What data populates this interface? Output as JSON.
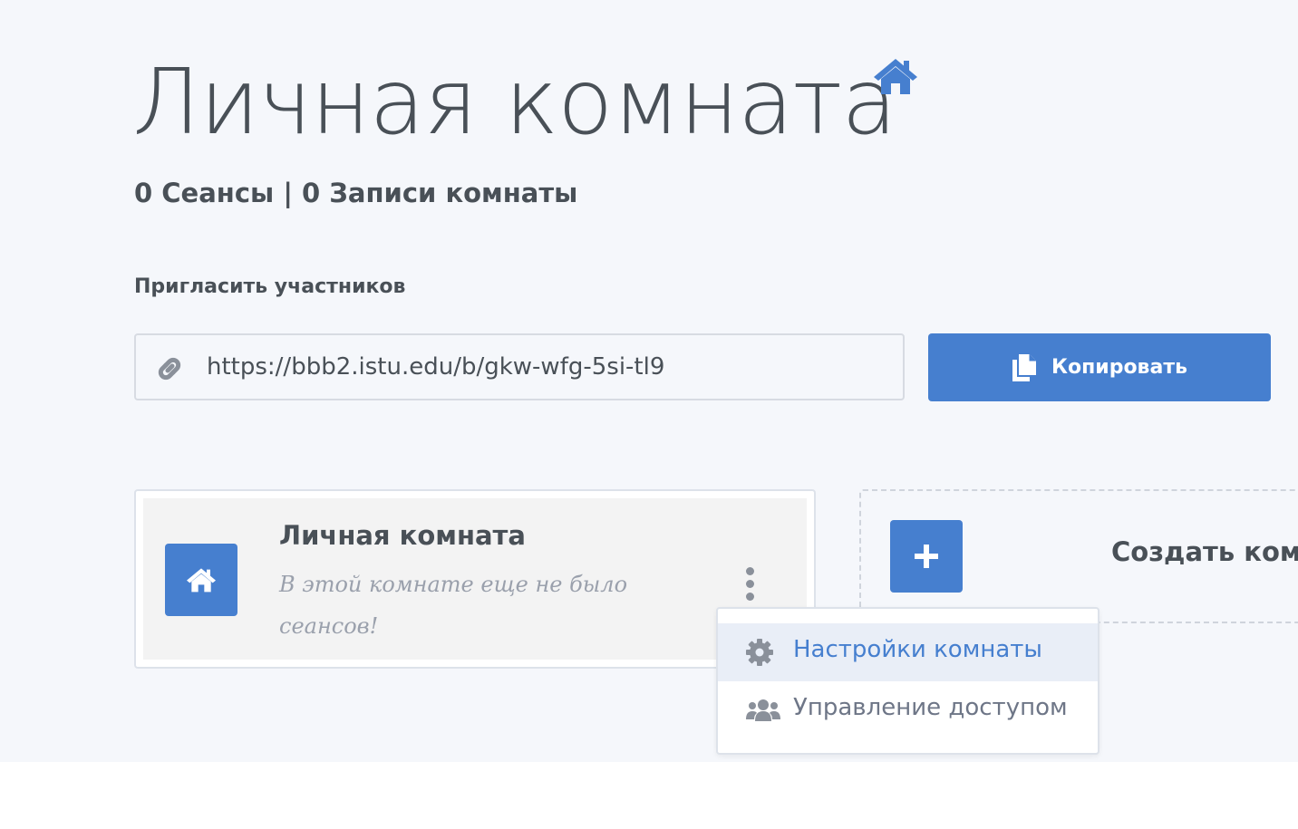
{
  "header": {
    "title": "Личная комната",
    "title_icon": "home-icon"
  },
  "stats": {
    "text": "0 Сеансы | 0 Записи комнаты"
  },
  "invite": {
    "label": "Пригласить участников",
    "url": "https://bbb2.istu.edu/b/gkw-wfg-5si-tl9",
    "copy_button": "Копировать",
    "link_icon": "link-icon",
    "copy_icon": "copy-icon"
  },
  "room_card": {
    "name": "Личная комната",
    "status": "В этой комнате еще не было сеансов!",
    "icon": "home-icon"
  },
  "create_card": {
    "label": "Создать комнату"
  },
  "dropdown": {
    "items": [
      {
        "label": "Настройки комнаты",
        "icon": "gear-icon",
        "active": true
      },
      {
        "label": "Управление доступом",
        "icon": "users-icon",
        "active": false
      }
    ]
  },
  "colors": {
    "primary": "#467fcf",
    "text": "#495057",
    "muted": "#9aa0ac",
    "background": "#f5f7fb"
  }
}
